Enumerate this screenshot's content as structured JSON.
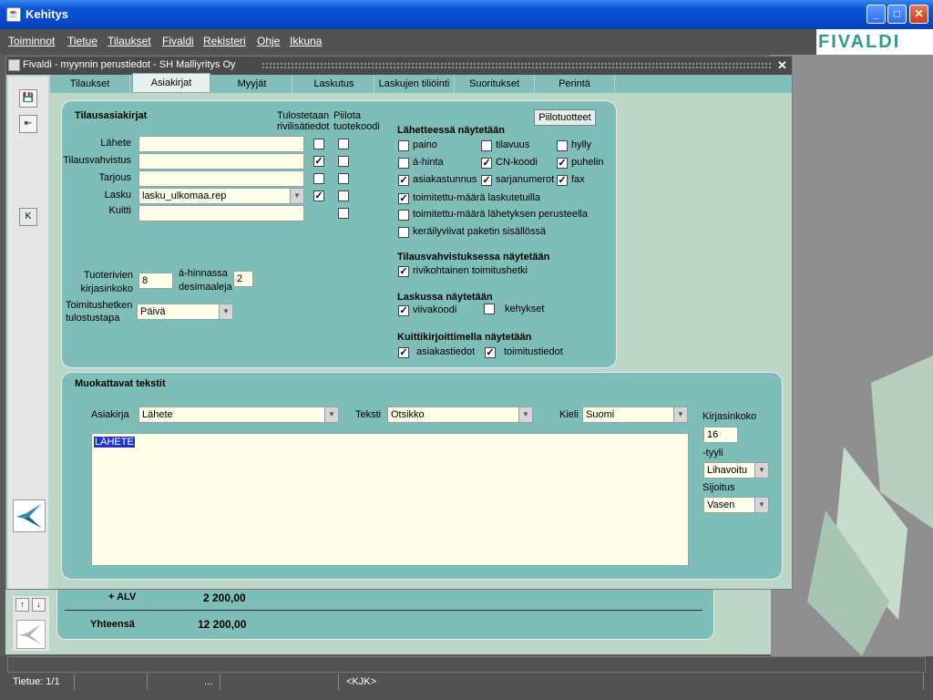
{
  "window": {
    "title": "Kehitys",
    "minimize": "_",
    "maximize": "□",
    "close": "✕"
  },
  "menu": [
    "Toiminnot",
    "Tietue",
    "Tilaukset",
    "Fivaldi",
    "Rekisteri",
    "Ohje",
    "Ikkuna"
  ],
  "brand": "FIVALDI",
  "inner": {
    "title": "Fivaldi - myynnin perustiedot - SH Malliyritys Oy",
    "close": "✕"
  },
  "tabs": [
    "Tilaukset",
    "Asiakirjat",
    "Myyjät",
    "Laskutus",
    "Laskujen tiliöinti",
    "Suoritukset",
    "Perintä"
  ],
  "active_tab": "Asiakirjat",
  "toolbar": {
    "k_label": "K"
  },
  "tilaus": {
    "title": "Tilausasiakirjat",
    "col1": "Tulostetaan rivilisätiedot",
    "col2": "Piilota tuotekoodi",
    "rows": [
      {
        "label": "Lähete",
        "value": "",
        "c1": false,
        "c2": false
      },
      {
        "label": "Tilausvahvistus",
        "value": "",
        "c1": true,
        "c2": false
      },
      {
        "label": "Tarjous",
        "value": "",
        "c1": false,
        "c2": false
      },
      {
        "label": "Lasku",
        "value": "lasku_ulkomaa.rep",
        "c1": true,
        "c2": false
      },
      {
        "label": "Kuitti",
        "value": "",
        "c2": false
      }
    ],
    "piilotuotteet": "Piilotuotteet",
    "fontsize_label": "Tuoterivien kirjasinkoko",
    "fontsize_value": "8",
    "decimals_label": "á-hinnassa desimaaleja",
    "decimals_value": "2",
    "delivery_label": "Toimitushetken tulostustapa",
    "delivery_value": "Päivä"
  },
  "lahete": {
    "title": "Lähetteessä näytetään",
    "opts": [
      {
        "label": "paino",
        "checked": false
      },
      {
        "label": "tilavuus",
        "checked": false
      },
      {
        "label": "hylly",
        "checked": false
      },
      {
        "label": "á-hinta",
        "checked": false
      },
      {
        "label": "CN-koodi",
        "checked": true
      },
      {
        "label": "puhelin",
        "checked": true
      },
      {
        "label": "asiakastunnus",
        "checked": true
      },
      {
        "label": "sarjanumerot",
        "checked": true
      },
      {
        "label": "fax",
        "checked": true
      }
    ],
    "long": [
      {
        "label": "toimitettu-määrä laskutetuilla",
        "checked": true
      },
      {
        "label": "toimitettu-määrä lähetyksen perusteella",
        "checked": false
      },
      {
        "label": "keräilyviivat paketin sisällössä",
        "checked": false
      }
    ]
  },
  "tilausvahv": {
    "title": "Tilausvahvistuksessa näytetään",
    "opt": {
      "label": "rivikohtainen toimitushetki",
      "checked": true
    }
  },
  "laskussa": {
    "title": "Laskussa näytetään",
    "opts": [
      {
        "label": "viivakoodi",
        "checked": true
      },
      {
        "label": "kehykset",
        "checked": false
      }
    ]
  },
  "kuitti": {
    "title": "Kuittikirjoittimella näytetään",
    "opts": [
      {
        "label": "asiakastiedot",
        "checked": true
      },
      {
        "label": "toimitustiedot",
        "checked": true
      }
    ]
  },
  "custom": {
    "title": "Muokattavat tekstit",
    "asiakirja_label": "Asiakirja",
    "asiakirja_value": "Lähete",
    "teksti_label": "Teksti",
    "teksti_value": "Otsikko",
    "kieli_label": "Kieli",
    "kieli_value": "Suomi",
    "text": "LÄHETE",
    "size_label": "Kirjasinkoko",
    "size_value": "16",
    "style_label": "-tyyli",
    "style_value": "Lihavoitu",
    "pos_label": "Sijoitus",
    "pos_value": "Vasen"
  },
  "background": {
    "alv_label": "+ ALV",
    "alv_value": "2 200,00",
    "total_label": "Yhteensä",
    "total_value": "12 200,00"
  },
  "status": {
    "record": "Tietue: 1/1",
    "dots": "...",
    "user": "<KJK>"
  }
}
